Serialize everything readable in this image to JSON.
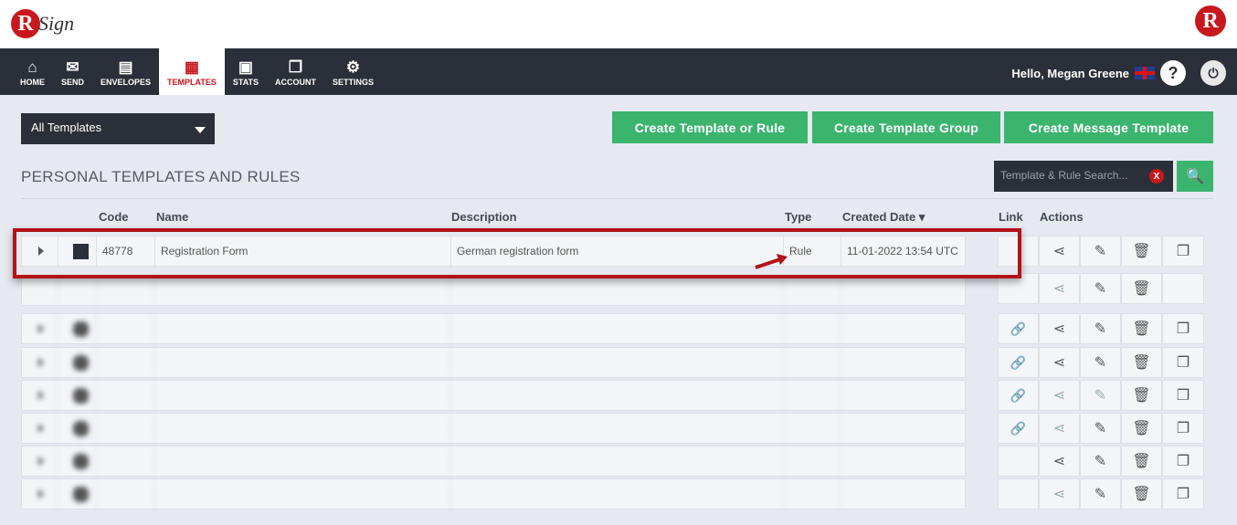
{
  "brand": {
    "logo_letter": "R",
    "logo_text": "Sign",
    "right_letter": "R"
  },
  "nav": {
    "items": [
      {
        "label": "HOME",
        "icon": "home-icon",
        "glyph": "⌂"
      },
      {
        "label": "SEND",
        "icon": "envelope-icon",
        "glyph": "✉"
      },
      {
        "label": "ENVELOPES",
        "icon": "inbox-icon",
        "glyph": "▤"
      },
      {
        "label": "TEMPLATES",
        "icon": "document-icon",
        "glyph": "▦"
      },
      {
        "label": "STATS",
        "icon": "briefcase-icon",
        "glyph": "▣"
      },
      {
        "label": "ACCOUNT",
        "icon": "copy-icon",
        "glyph": "❐"
      },
      {
        "label": "SETTINGS",
        "icon": "gear-icon",
        "glyph": "⚙"
      }
    ],
    "greeting": "Hello, Megan Greene",
    "help_glyph": "?",
    "power_glyph": "⏻"
  },
  "toolbar": {
    "filter_value": "All Templates",
    "btn_create_template": "Create Template or Rule",
    "btn_create_group": "Create Template Group",
    "btn_create_message": "Create Message Template",
    "search_placeholder": "Template & Rule Search...",
    "clear_glyph": "X",
    "search_glyph": "🔍"
  },
  "section": {
    "title": "PERSONAL TEMPLATES AND RULES"
  },
  "table": {
    "headers": {
      "code": "Code",
      "name": "Name",
      "description": "Description",
      "type": "Type",
      "created": "Created Date",
      "link": "Link",
      "actions": "Actions"
    },
    "highlighted_row": {
      "code": "48778",
      "name": "Registration Form",
      "description": "German registration form",
      "type": "Rule",
      "created": "11-01-2022 13:54 UTC"
    }
  },
  "icons": {
    "link": "🔗",
    "share": "⋖",
    "edit": "✎",
    "delete": "🗑",
    "copy": "❐"
  },
  "colors": {
    "accent_green": "#3bb46e",
    "brand_red": "#c8171d",
    "nav_dark": "#2b2f3a"
  }
}
